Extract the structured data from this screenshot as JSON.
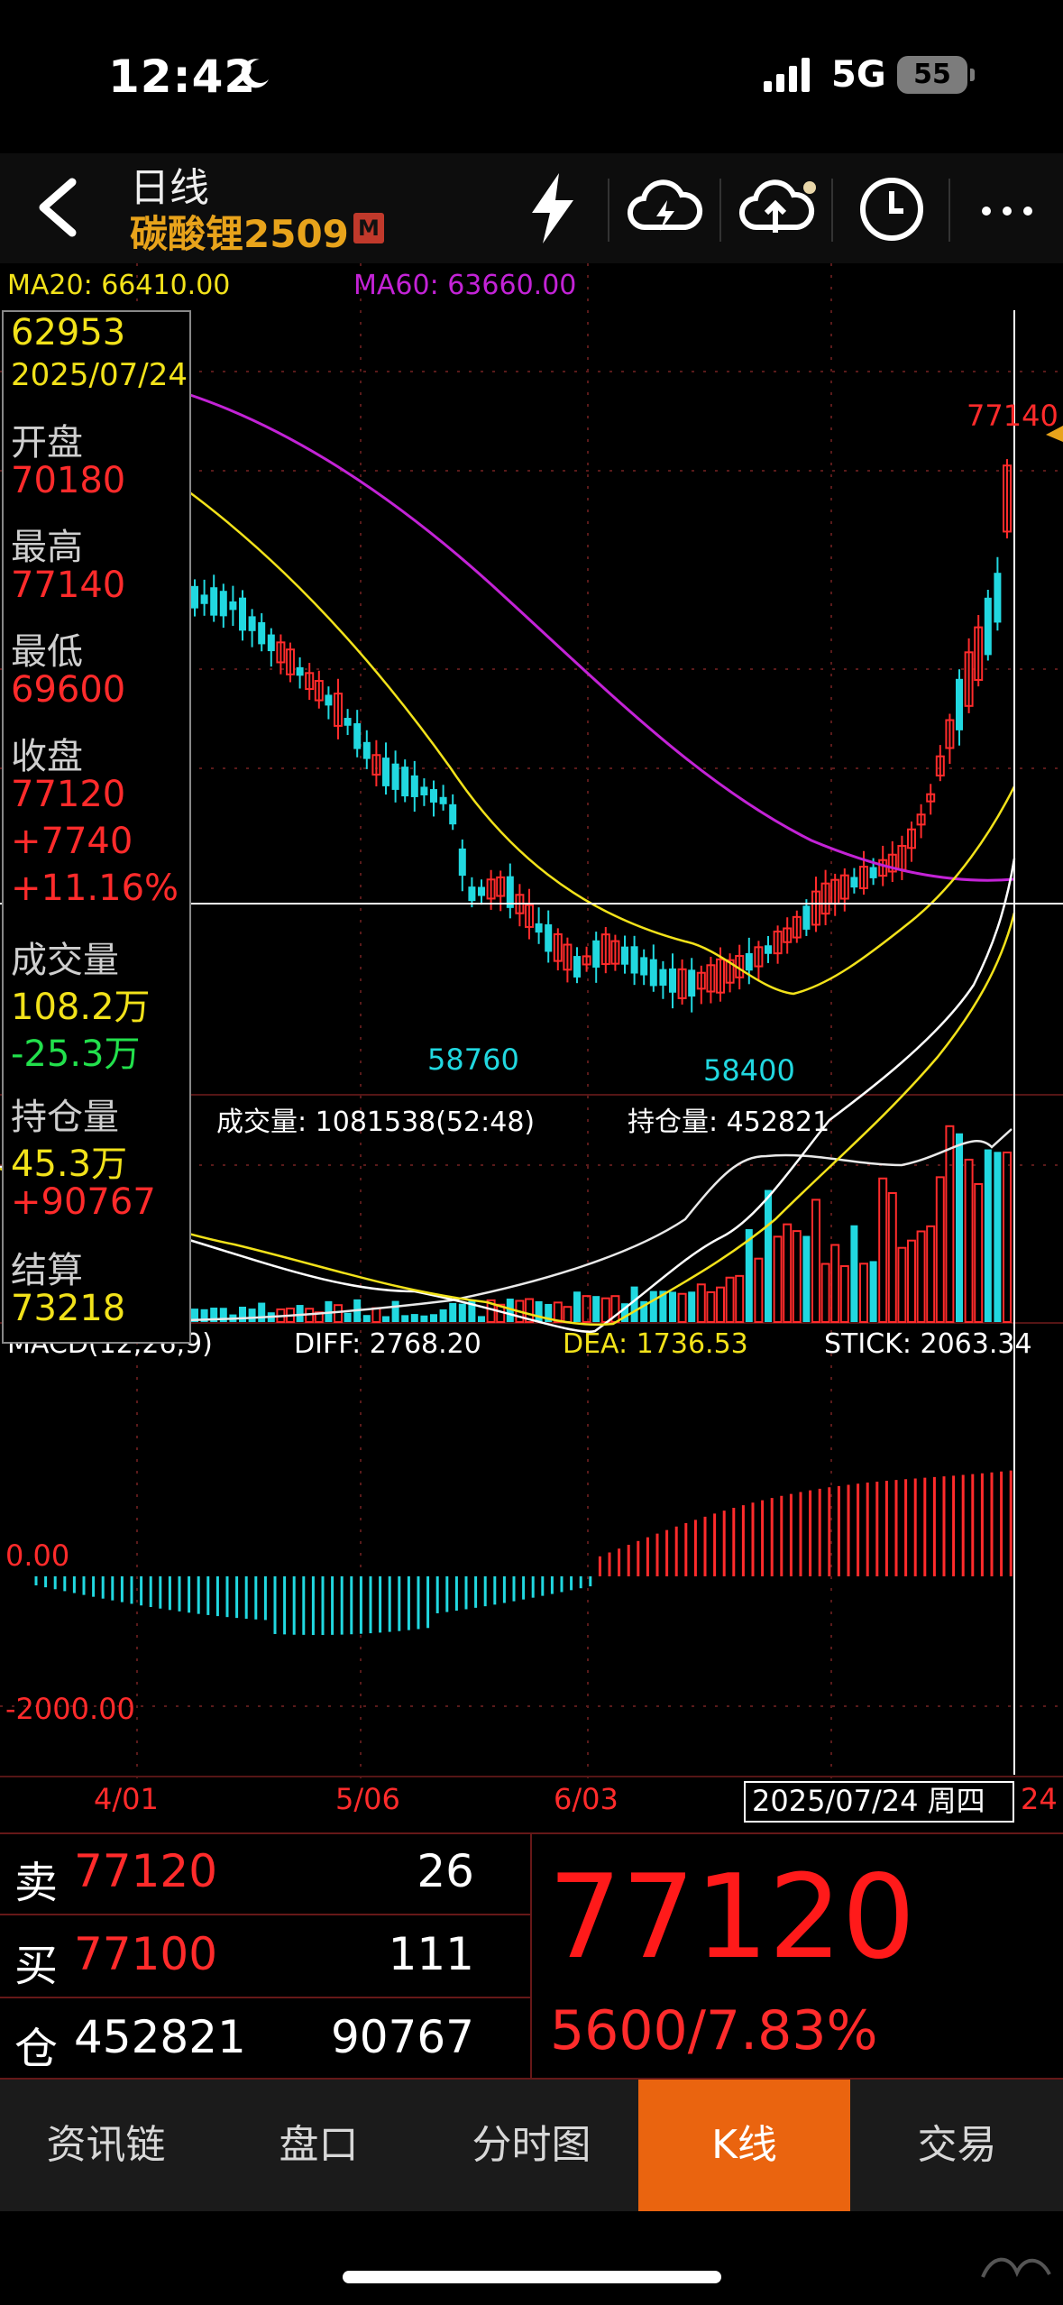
{
  "status_bar": {
    "time": "12:42",
    "network": "5G",
    "battery": "55"
  },
  "header": {
    "period": "日线",
    "symbol": "碳酸锂2509",
    "badge": "M"
  },
  "chart": {
    "ma20_label": "MA20: 66410.00",
    "ma60_label": "MA60: 63660.00",
    "high_label": "77140",
    "low_labels": [
      "58760",
      "58400"
    ],
    "volume_label": "成交量: 1081538(52:48)",
    "oi_label": "持仓量: 452821",
    "macd_label": "MACD(12,26,9)",
    "diff_label": "DIFF: 2768.20",
    "dea_label": "DEA: 1736.53",
    "stick_label": "STICK: 2063.34",
    "macd_zero": "0.00",
    "macd_neg": "-2000.00",
    "date_ticks": [
      "4/01",
      "5/06",
      "6/03",
      "24"
    ],
    "cursor_date": "2025/07/24 周四",
    "colors": {
      "up": "#ff2b2b",
      "down": "#21d8e0",
      "ma20": "#f2e21a",
      "ma60": "#c323d6"
    }
  },
  "info": {
    "price": "62953",
    "date": "2025/07/24",
    "open_label": "开盘",
    "open": "70180",
    "high_label": "最高",
    "high": "77140",
    "low_label": "最低",
    "low": "69600",
    "close_label": "收盘",
    "close": "77120",
    "chg": "+7740",
    "chg_pct": "+11.16%",
    "vol_label": "成交量",
    "vol": "108.2万",
    "vol_chg": "-25.3万",
    "oi_label": "持仓量",
    "oi": "45.3万",
    "oi_chg": "+90767",
    "settle_label": "结算",
    "settle": "73218"
  },
  "trade": {
    "rows": [
      {
        "label": "卖",
        "price": "77120",
        "vol": "26"
      },
      {
        "label": "买",
        "price": "77100",
        "vol": "111"
      },
      {
        "label": "仓",
        "price": "452821",
        "vol": "90767"
      }
    ],
    "last_price": "77120",
    "change": "5600/7.83%"
  },
  "tabs": [
    "资讯链",
    "盘口",
    "分时图",
    "K线",
    "交易"
  ],
  "active_tab": 3
}
